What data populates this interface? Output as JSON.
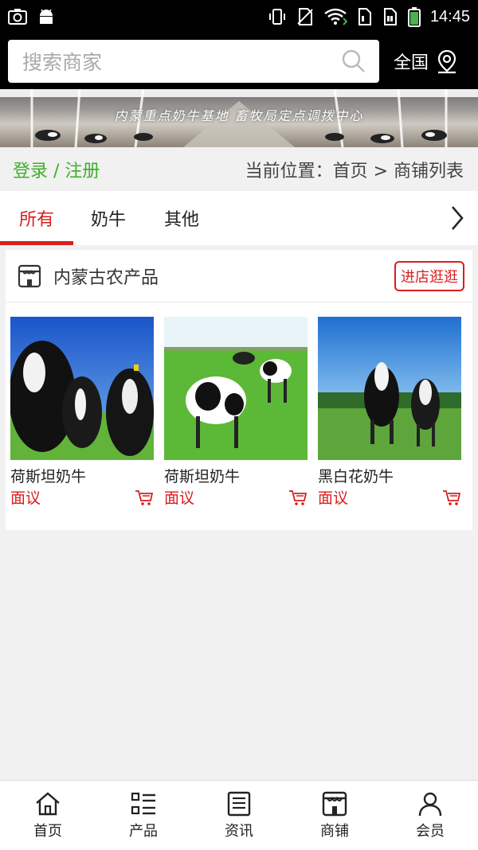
{
  "status_bar": {
    "time": "14:45",
    "icons": [
      "camera-icon",
      "android-icon",
      "vibrate-icon",
      "no-sim-icon",
      "wifi-icon",
      "sim1-icon",
      "sim2-icon",
      "battery-icon"
    ]
  },
  "header": {
    "search_placeholder": "搜索商家",
    "region_label": "全国",
    "region_icon": "location-pin-icon"
  },
  "banner": {
    "caption": "内蒙重点奶牛基地  畜牧局定点调拨中心"
  },
  "breadcrumb_bar": {
    "login_label": "登录 / 注册",
    "location_text": "当前位置：首页 > 商铺列表"
  },
  "tabs": {
    "items": [
      {
        "label": "所有",
        "active": true
      },
      {
        "label": "奶牛",
        "active": false
      },
      {
        "label": "其他",
        "active": false
      }
    ],
    "more_icon": "chevron-right-icon"
  },
  "store": {
    "name": "内蒙古农产品",
    "enter_label": "进店逛逛",
    "products": [
      {
        "name": "荷斯坦奶牛",
        "price": "面议"
      },
      {
        "name": "荷斯坦奶牛",
        "price": "面议"
      },
      {
        "name": "黑白花奶牛",
        "price": "面议"
      }
    ]
  },
  "bottom_nav": {
    "items": [
      {
        "label": "首页",
        "icon": "home-icon"
      },
      {
        "label": "产品",
        "icon": "list-icon"
      },
      {
        "label": "资讯",
        "icon": "news-icon"
      },
      {
        "label": "商铺",
        "icon": "store-icon"
      },
      {
        "label": "会员",
        "icon": "user-icon"
      }
    ]
  },
  "colors": {
    "accent_red": "#d81e1e",
    "login_green": "#3fae2a",
    "header_black": "#000000"
  }
}
